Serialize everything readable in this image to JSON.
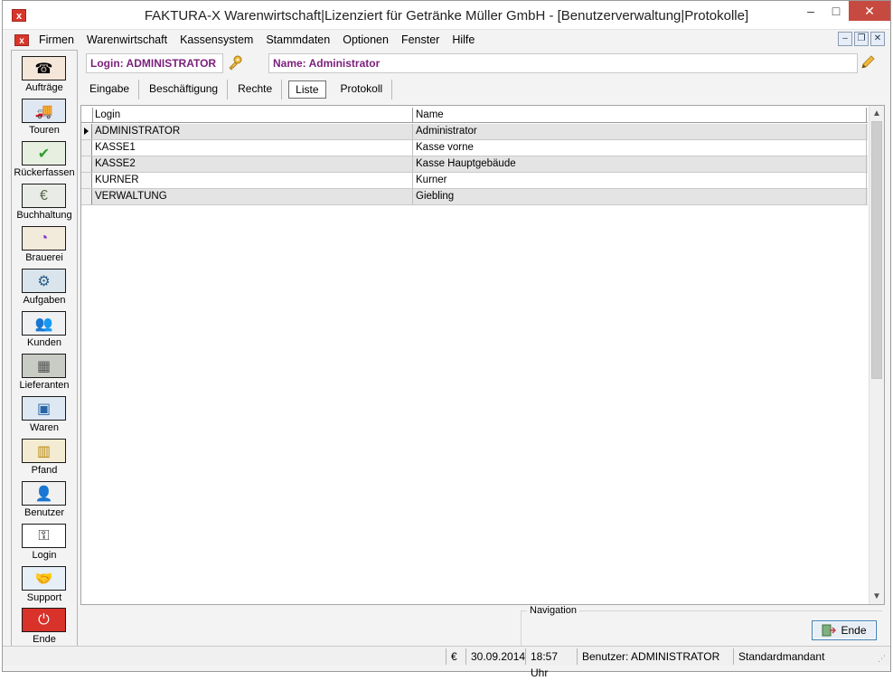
{
  "window": {
    "title": "FAKTURA-X Warenwirtschaft|Lizenziert für Getränke Müller GmbH - [Benutzerverwaltung|Protokolle]",
    "app_icon": "x",
    "controls": {
      "minimize": "–",
      "maximize": "□",
      "close": "✕"
    }
  },
  "menu": {
    "items": [
      "Firmen",
      "Warenwirtschaft",
      "Kassensystem",
      "Stammdaten",
      "Optionen",
      "Fenster",
      "Hilfe"
    ],
    "mdi_controls": {
      "minimize": "–",
      "restore": "❐",
      "close": "✕"
    }
  },
  "sidebar": {
    "items": [
      {
        "label": "Aufträge",
        "icon": "headset-agent-icon",
        "glyph": "☎"
      },
      {
        "label": "Touren",
        "icon": "truck-icon",
        "glyph": "🚚"
      },
      {
        "label": "Rückerfassen",
        "icon": "truck-check-icon",
        "glyph": "✔"
      },
      {
        "label": "Buchhaltung",
        "icon": "money-icon",
        "glyph": "€"
      },
      {
        "label": "Brauerei",
        "icon": "brewery-chart-icon",
        "glyph": "◔"
      },
      {
        "label": "Aufgaben",
        "icon": "tasks-icon",
        "glyph": "⚙"
      },
      {
        "label": "Kunden",
        "icon": "customers-icon",
        "glyph": "👥"
      },
      {
        "label": "Lieferanten",
        "icon": "suppliers-icon",
        "glyph": "▦"
      },
      {
        "label": "Waren",
        "icon": "goods-icon",
        "glyph": "▣"
      },
      {
        "label": "Pfand",
        "icon": "deposit-crate-icon",
        "glyph": "▥"
      },
      {
        "label": "Benutzer",
        "icon": "user-icon",
        "glyph": "👤"
      },
      {
        "label": "Login",
        "icon": "key-icon",
        "glyph": "⚿"
      },
      {
        "label": "Support",
        "icon": "handshake-icon",
        "glyph": "🤝"
      },
      {
        "label": "Ende",
        "icon": "power-icon",
        "glyph": "⏻"
      }
    ]
  },
  "header": {
    "login": "Login: ADMINISTRATOR",
    "name": "Name: Administrator"
  },
  "tabs": [
    "Eingabe",
    "Beschäftigung",
    "Rechte",
    "Liste",
    "Protokoll"
  ],
  "active_tab": "Liste",
  "grid": {
    "columns": [
      "Login",
      "Name"
    ],
    "rows": [
      {
        "login": "ADMINISTRATOR",
        "name": "Administrator"
      },
      {
        "login": "KASSE1",
        "name": "Kasse vorne"
      },
      {
        "login": "KASSE2",
        "name": "Kasse Hauptgebäude"
      },
      {
        "login": "KURNER",
        "name": "Kurner"
      },
      {
        "login": "VERWALTUNG",
        "name": "Giebling"
      }
    ]
  },
  "navigation": {
    "label": "Navigation",
    "ende_button": "Ende"
  },
  "statusbar": {
    "currency": "€",
    "date": "30.09.2014",
    "time": "18:57 Uhr",
    "user": "Benutzer: ADMINISTRATOR",
    "mandant": "Standardmandant"
  },
  "colors": {
    "header_text": "#7a1f7a",
    "close_button": "#c74a40",
    "alt_row": "#e4e4e4"
  }
}
